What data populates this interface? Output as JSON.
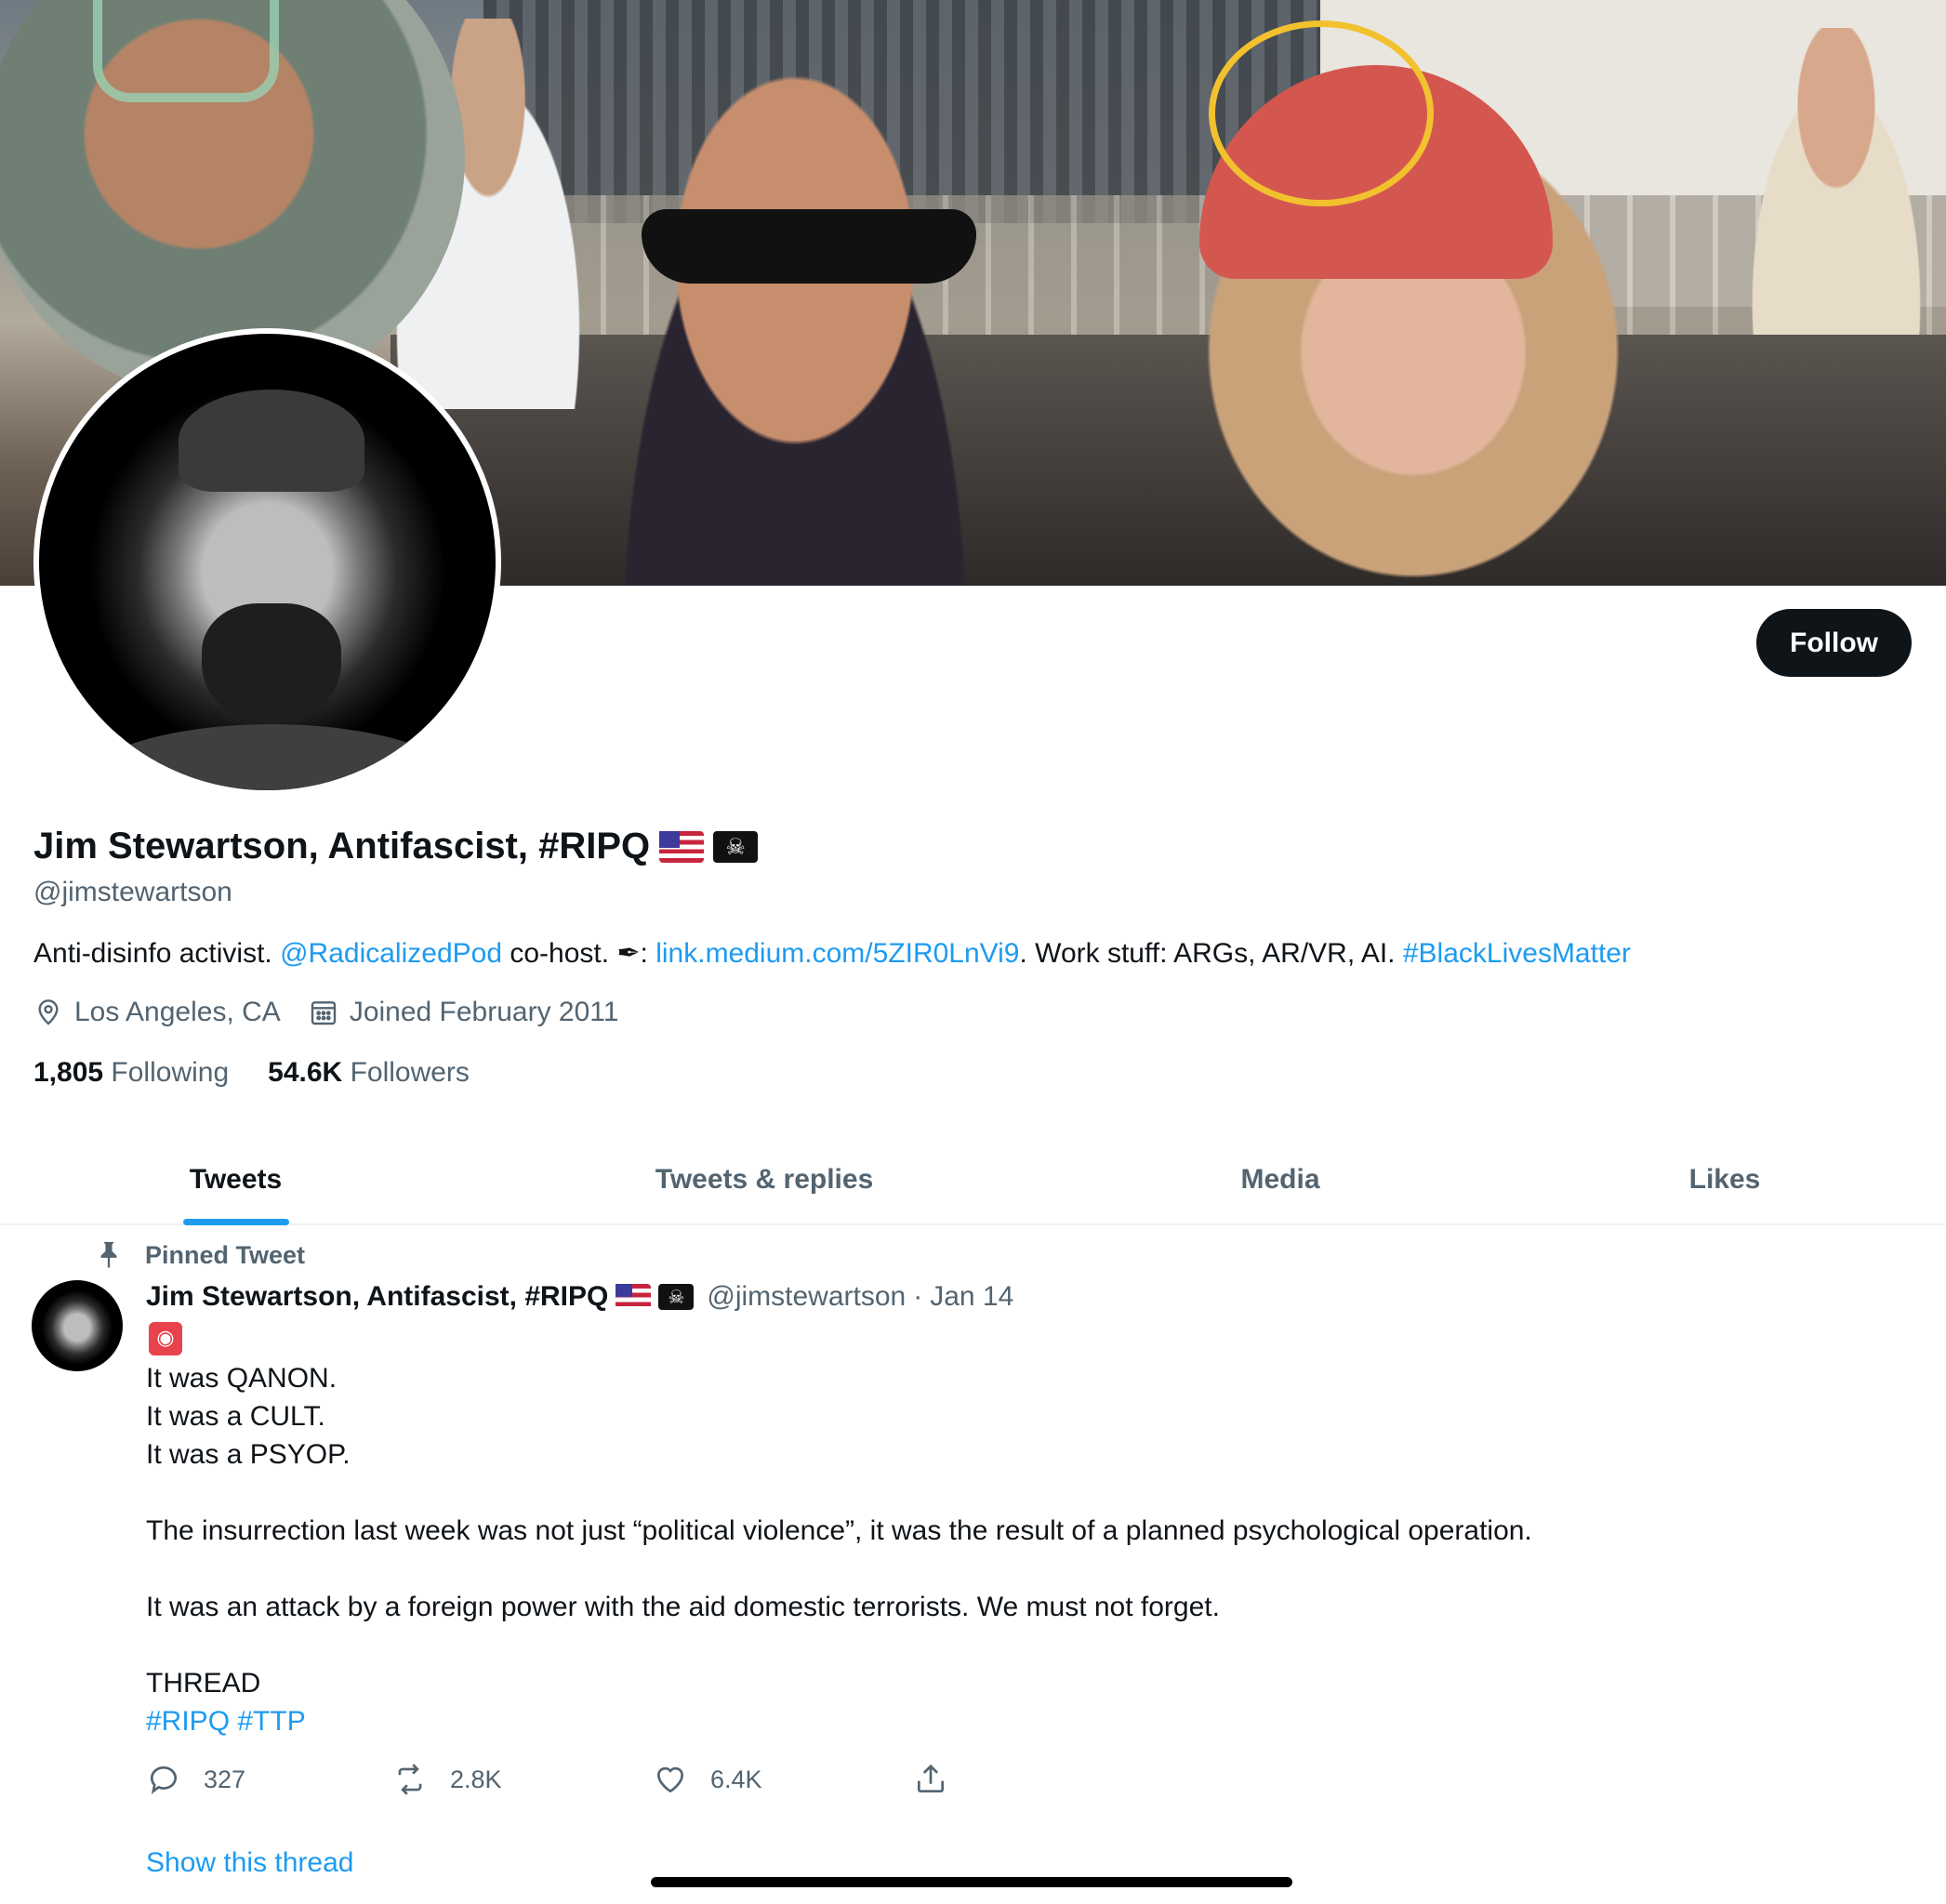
{
  "profile": {
    "display_name": "Jim Stewartson, Antifascist, #RIPQ",
    "handle": "@jimstewartson",
    "follow_label": "Follow",
    "bio": {
      "part1": "Anti-disinfo activist. ",
      "mention": "@RadicalizedPod",
      "part2": " co-host. ",
      "pen_emoji": "✒",
      "part3": ": ",
      "link": "link.medium.com/5ZIR0LnVi9",
      "part4": ". Work stuff: ARGs, AR/VR, AI. ",
      "hashtag": "#BlackLivesMatter"
    },
    "location": "Los Angeles, CA",
    "joined": "Joined February 2011",
    "following_count": "1,805",
    "following_label": "Following",
    "followers_count": "54.6K",
    "followers_label": "Followers",
    "name_emojis": [
      "us-flag",
      "skull-crossbones-flag"
    ]
  },
  "tabs": [
    {
      "label": "Tweets",
      "active": true
    },
    {
      "label": "Tweets & replies",
      "active": false
    },
    {
      "label": "Media",
      "active": false
    },
    {
      "label": "Likes",
      "active": false
    }
  ],
  "pinned_tweet": {
    "pinned_label": "Pinned Tweet",
    "author_name": "Jim Stewartson, Antifascist, #RIPQ",
    "author_handle": "@jimstewartson",
    "separator": "·",
    "date": "Jan 14",
    "lead_emoji": "siren",
    "lines": [
      "It was QANON.",
      "It was a CULT.",
      "It was a PSYOP."
    ],
    "paragraph1": "The insurrection last week was not just “political violence”, it was the result of a planned psychological operation.",
    "paragraph2": "It was an attack by a foreign power with the aid domestic terrorists. We must not forget.",
    "thread_label": "THREAD",
    "hashtags": "#RIPQ #TTP",
    "replies": "327",
    "retweets": "2.8K",
    "likes": "6.4K",
    "show_thread": "Show this thread"
  },
  "colors": {
    "accent": "#1d9bf0",
    "text_primary": "#0f1419",
    "text_secondary": "#536471",
    "follow_bg": "#0f1419",
    "highlight_circle": "#f2c12e"
  }
}
